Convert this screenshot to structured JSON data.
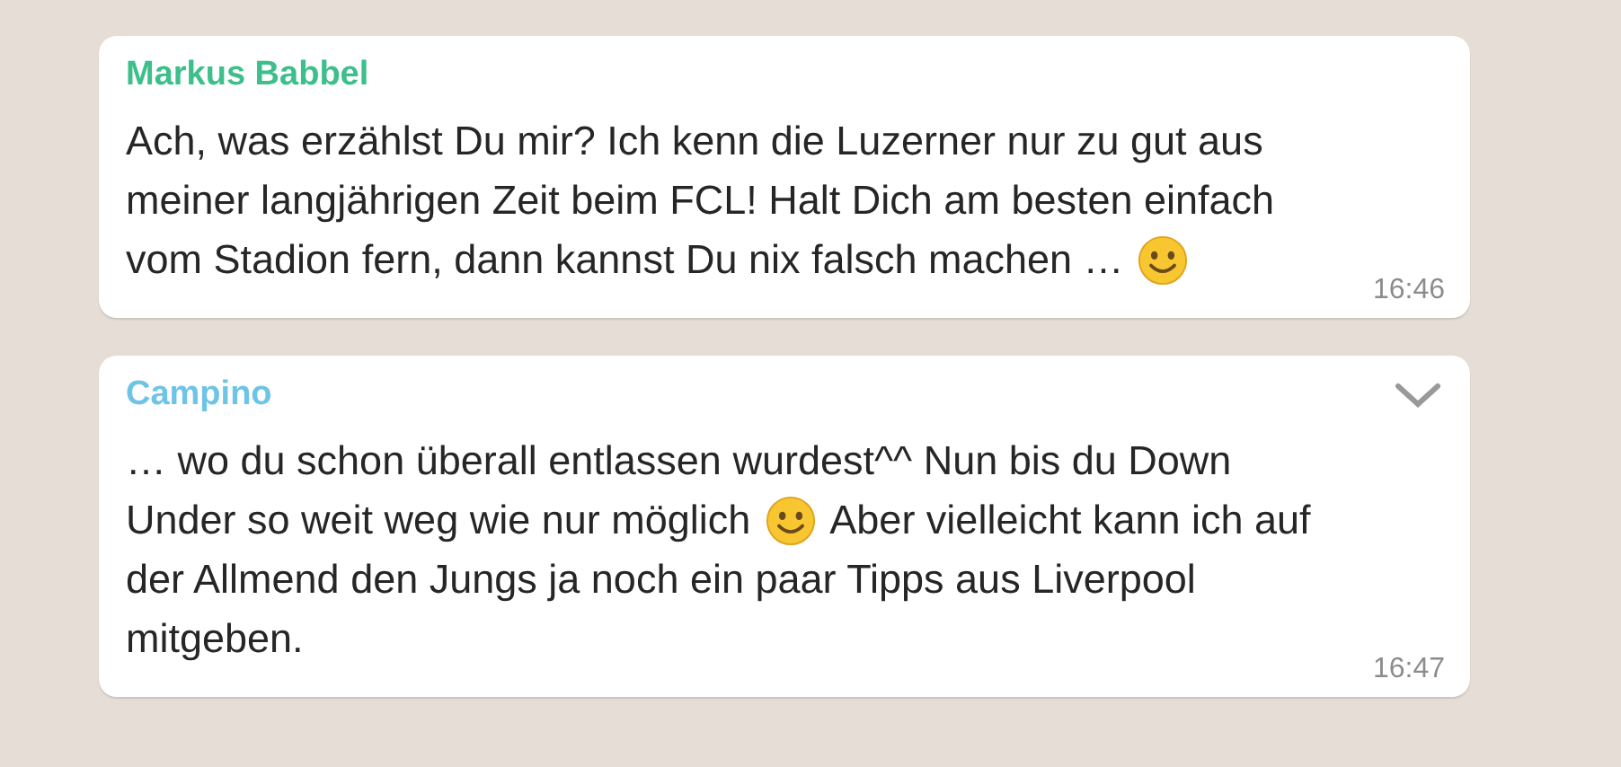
{
  "messages": [
    {
      "sender": "Markus Babbel",
      "color": "#3dbf8c",
      "menu_visible": false,
      "time": "16:46",
      "lines": [
        [
          {
            "kind": "text",
            "text": "Ach, was erzählst Du mir? Ich kenn die Luzerner nur zu gut aus"
          }
        ],
        [
          {
            "kind": "text",
            "text": "meiner langjährigen Zeit beim FCL! Halt Dich am besten einfach"
          }
        ],
        [
          {
            "kind": "text",
            "text": "vom Stadion fern, dann kannst Du nix falsch machen …"
          },
          {
            "kind": "emoji"
          }
        ]
      ]
    },
    {
      "sender": "Campino",
      "color": "#6ec4e6",
      "menu_visible": true,
      "time": "16:47",
      "lines": [
        [
          {
            "kind": "text",
            "text": "… wo du schon überall entlassen wurdest^^ Nun bis du Down"
          }
        ],
        [
          {
            "kind": "text",
            "text": "Under so weit weg wie nur möglich"
          },
          {
            "kind": "emoji"
          },
          {
            "kind": "text",
            "text": "Aber vielleicht kann ich auf"
          }
        ],
        [
          {
            "kind": "text",
            "text": "der Allmend den Jungs ja noch ein paar Tipps aus Liverpool"
          }
        ],
        [
          {
            "kind": "text",
            "text": "mitgeben."
          }
        ]
      ]
    }
  ]
}
